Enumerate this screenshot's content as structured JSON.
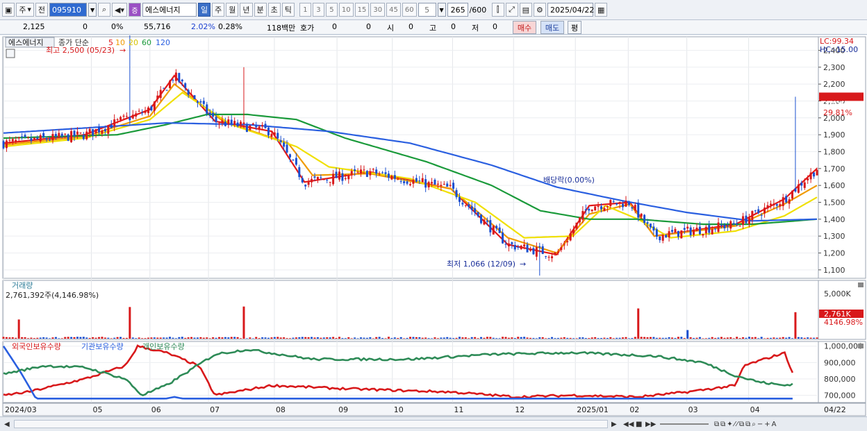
{
  "toolbar": {
    "market_label": "주",
    "prev_label": "전",
    "stock_code": "095910",
    "stock_name": "에스에너지",
    "period_tabs": [
      "일",
      "주",
      "월",
      "년",
      "분",
      "초",
      "틱"
    ],
    "active_period": "일",
    "minute_steps": [
      "1",
      "3",
      "5",
      "10",
      "15",
      "30",
      "45",
      "60"
    ],
    "step_value": "5",
    "count_value": "265",
    "count_max": "/600",
    "date_value": "2025/04/22"
  },
  "quote": {
    "price": "2,125",
    "change": "0",
    "change_pct": "0%",
    "volume": "55,716",
    "volume_pct": "2.02%",
    "turnover": "0.28%",
    "amount": "118백만",
    "hoga_label": "호가",
    "hoga_a": "0",
    "hoga_b": "0",
    "open_label": "시",
    "open_val": "0",
    "high_label": "고",
    "high_val": "0",
    "low_label": "저",
    "low_val": "0",
    "buy_label": "매수",
    "sell_label": "매도",
    "eval_label": "평"
  },
  "price_panel": {
    "stock_name": "에스에너지",
    "legend_prefix": "종가 단순",
    "ma_periods": [
      "5",
      "10",
      "20",
      "60",
      "120"
    ],
    "ma_colors": [
      "#e31818",
      "#f09a00",
      "#f0e000",
      "#1a9a3a",
      "#2a5fe0"
    ],
    "high_note": "최고 2,500 (05/23)",
    "low_note": "최저 1,066 (12/09)",
    "dividend_note": "배당락(0.00%)",
    "lc_label": "LC:99.34",
    "hc_label": "HC:-15.00",
    "current_price": "2,125",
    "current_pct": "29.81%",
    "y_ticks": [
      "2,400",
      "2,300",
      "2,200",
      "2,100",
      "2,000",
      "1,900",
      "1,800",
      "1,700",
      "1,600",
      "1,500",
      "1,400",
      "1,300",
      "1,200",
      "1,100"
    ]
  },
  "volume_panel": {
    "title": "거래량",
    "value_note": "2,761,392주(4,146.98%)",
    "y_tick": "5,000K",
    "current_value": "2,761K",
    "current_pct": "4146.98%"
  },
  "holding_panel": {
    "legend": [
      "외국인보유수량",
      "기관보유수량",
      "개인보유수량"
    ],
    "legend_colors": [
      "#d8191b",
      "#2a5fe0",
      "#2e8b57"
    ],
    "y_ticks": [
      "1,000,000",
      "900,000",
      "800,000",
      "700,000"
    ]
  },
  "x_axis": {
    "labels": [
      "2024/03",
      "05",
      "06",
      "07",
      "08",
      "09",
      "10",
      "11",
      "12",
      "2025/01",
      "02",
      "03",
      "04"
    ],
    "end_label": "04/22"
  },
  "chart_data": [
    {
      "type": "candlestick",
      "x_range": [
        "2024/03",
        "2025/04/22"
      ],
      "ylim": [
        1050,
        2480
      ],
      "highlights": {
        "max": {
          "value": 2500,
          "date": "05/23"
        },
        "min": {
          "value": 1066,
          "date": "12/09"
        },
        "last": 2125
      },
      "series": [
        {
          "name": "5",
          "anchors": [
            [
              0,
              1850
            ],
            [
              0.1,
              1900
            ],
            [
              0.18,
              2050
            ],
            [
              0.21,
              2250
            ],
            [
              0.26,
              1980
            ],
            [
              0.33,
              1920
            ],
            [
              0.37,
              1620
            ],
            [
              0.45,
              1680
            ],
            [
              0.55,
              1580
            ],
            [
              0.62,
              1250
            ],
            [
              0.68,
              1190
            ],
            [
              0.72,
              1480
            ],
            [
              0.77,
              1500
            ],
            [
              0.8,
              1300
            ],
            [
              0.9,
              1370
            ],
            [
              0.96,
              1520
            ],
            [
              1.0,
              1700
            ]
          ]
        },
        {
          "name": "10",
          "anchors": [
            [
              0,
              1840
            ],
            [
              0.1,
              1890
            ],
            [
              0.18,
              2010
            ],
            [
              0.21,
              2200
            ],
            [
              0.27,
              1980
            ],
            [
              0.35,
              1850
            ],
            [
              0.38,
              1660
            ],
            [
              0.45,
              1670
            ],
            [
              0.55,
              1580
            ],
            [
              0.62,
              1290
            ],
            [
              0.68,
              1200
            ],
            [
              0.72,
              1430
            ],
            [
              0.77,
              1490
            ],
            [
              0.8,
              1300
            ],
            [
              0.9,
              1360
            ],
            [
              0.96,
              1490
            ],
            [
              1.0,
              1600
            ]
          ]
        },
        {
          "name": "20",
          "anchors": [
            [
              0,
              1830
            ],
            [
              0.1,
              1880
            ],
            [
              0.18,
              1990
            ],
            [
              0.22,
              2150
            ],
            [
              0.28,
              1960
            ],
            [
              0.36,
              1830
            ],
            [
              0.4,
              1710
            ],
            [
              0.5,
              1640
            ],
            [
              0.58,
              1500
            ],
            [
              0.64,
              1290
            ],
            [
              0.7,
              1300
            ],
            [
              0.74,
              1480
            ],
            [
              0.78,
              1400
            ],
            [
              0.82,
              1290
            ],
            [
              0.9,
              1330
            ],
            [
              0.96,
              1420
            ],
            [
              1.0,
              1530
            ]
          ]
        },
        {
          "name": "60",
          "anchors": [
            [
              0,
              1880
            ],
            [
              0.14,
              1900
            ],
            [
              0.2,
              1960
            ],
            [
              0.25,
              2020
            ],
            [
              0.3,
              2020
            ],
            [
              0.36,
              1990
            ],
            [
              0.42,
              1880
            ],
            [
              0.52,
              1740
            ],
            [
              0.6,
              1600
            ],
            [
              0.66,
              1450
            ],
            [
              0.72,
              1400
            ],
            [
              0.78,
              1400
            ],
            [
              0.86,
              1370
            ],
            [
              0.92,
              1370
            ],
            [
              1.0,
              1400
            ]
          ]
        },
        {
          "name": "120",
          "anchors": [
            [
              0,
              1910
            ],
            [
              0.2,
              1970
            ],
            [
              0.3,
              1960
            ],
            [
              0.4,
              1920
            ],
            [
              0.5,
              1850
            ],
            [
              0.6,
              1720
            ],
            [
              0.68,
              1590
            ],
            [
              0.76,
              1510
            ],
            [
              0.84,
              1440
            ],
            [
              0.92,
              1390
            ],
            [
              1.0,
              1400
            ]
          ]
        }
      ]
    },
    {
      "type": "bar",
      "title": "거래량",
      "unit": "K",
      "ylim": [
        0,
        6000
      ],
      "spikes": [
        {
          "x": 0.02,
          "value": 2000
        },
        {
          "x": 0.157,
          "value": 3300
        },
        {
          "x": 0.295,
          "value": 3350
        },
        {
          "x": 0.779,
          "value": 3150
        },
        {
          "x": 0.84,
          "value": 900
        },
        {
          "x": 0.975,
          "value": 2761
        }
      ]
    },
    {
      "type": "line",
      "series": [
        {
          "name": "외국인보유수량",
          "anchors": [
            [
              0,
              700000
            ],
            [
              0.03,
              720000
            ],
            [
              0.1,
              800000
            ],
            [
              0.15,
              880000
            ],
            [
              0.165,
              1000000
            ],
            [
              0.2,
              960000
            ],
            [
              0.24,
              880000
            ],
            [
              0.26,
              700000
            ],
            [
              0.33,
              760000
            ],
            [
              0.42,
              740000
            ],
            [
              0.55,
              720000
            ],
            [
              0.63,
              690000
            ],
            [
              0.7,
              700000
            ],
            [
              0.78,
              690000
            ],
            [
              0.84,
              720000
            ],
            [
              0.9,
              760000
            ],
            [
              0.91,
              880000
            ],
            [
              0.96,
              960000
            ],
            [
              0.97,
              840000
            ]
          ]
        },
        {
          "name": "기관보유수량",
          "anchors": [
            [
              0,
              1000000
            ],
            [
              0.02,
              850000
            ],
            [
              0.04,
              680000
            ],
            [
              0.2,
              680000
            ],
            [
              0.21,
              690000
            ],
            [
              0.22,
              680000
            ],
            [
              0.97,
              680000
            ]
          ]
        },
        {
          "name": "개인보유수량",
          "anchors": [
            [
              0,
              830000
            ],
            [
              0.05,
              880000
            ],
            [
              0.1,
              870000
            ],
            [
              0.15,
              800000
            ],
            [
              0.17,
              700000
            ],
            [
              0.2,
              760000
            ],
            [
              0.26,
              950000
            ],
            [
              0.3,
              980000
            ],
            [
              0.38,
              920000
            ],
            [
              0.5,
              920000
            ],
            [
              0.6,
              950000
            ],
            [
              0.7,
              960000
            ],
            [
              0.8,
              940000
            ],
            [
              0.86,
              900000
            ],
            [
              0.9,
              820000
            ],
            [
              0.93,
              780000
            ],
            [
              0.96,
              760000
            ],
            [
              0.97,
              770000
            ]
          ]
        }
      ]
    }
  ]
}
